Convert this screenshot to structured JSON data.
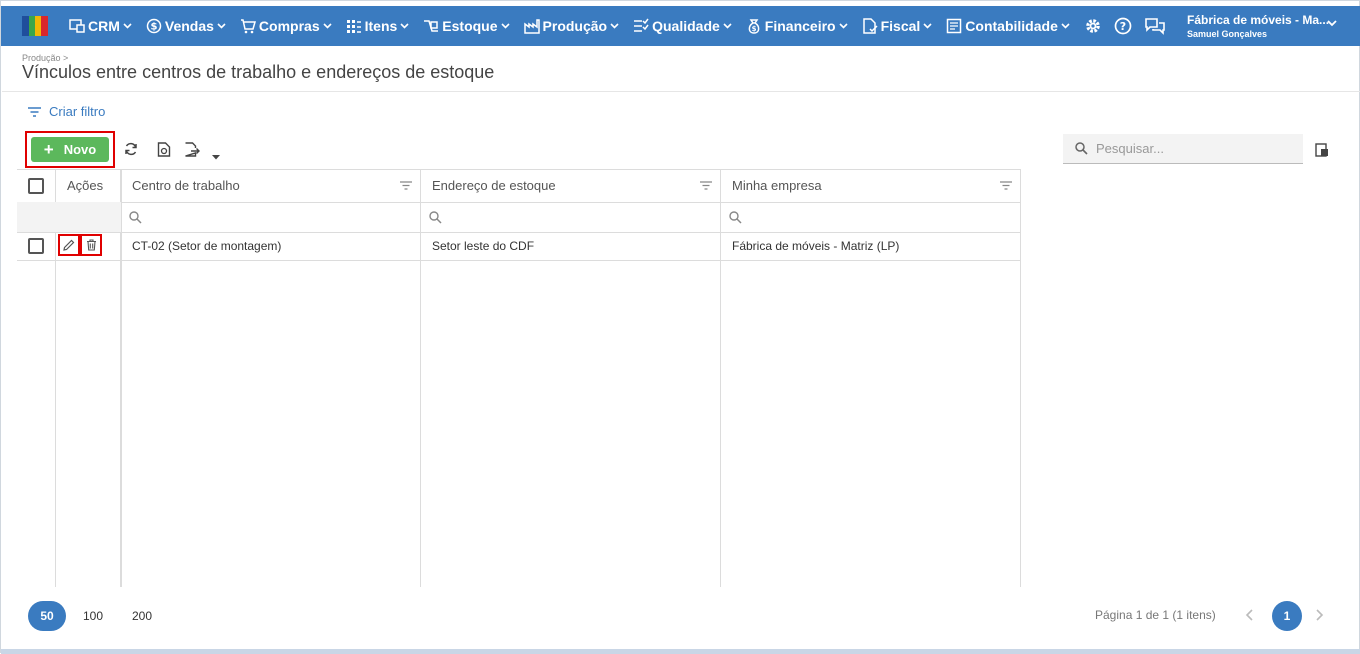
{
  "nav": {
    "items": [
      {
        "label": "CRM",
        "icon": "crm-icon"
      },
      {
        "label": "Vendas",
        "icon": "dollar-icon"
      },
      {
        "label": "Compras",
        "icon": "cart-icon"
      },
      {
        "label": "Itens",
        "icon": "items-icon"
      },
      {
        "label": "Estoque",
        "icon": "stock-icon"
      },
      {
        "label": "Produção",
        "icon": "factory-icon"
      },
      {
        "label": "Qualidade",
        "icon": "checklist-icon"
      },
      {
        "label": "Financeiro",
        "icon": "money-bag-icon"
      },
      {
        "label": "Fiscal",
        "icon": "document-check-icon"
      },
      {
        "label": "Contabilidade",
        "icon": "ledger-icon"
      }
    ],
    "company_name": "Fábrica de móveis - Ma...",
    "user_name": "Samuel Gonçalves",
    "accent_color": "#3a7bc0"
  },
  "header": {
    "breadcrumb": "Produção >",
    "title": "Vínculos entre centros de trabalho e endereços de estoque"
  },
  "toolbar": {
    "filter_label": "Criar filtro",
    "new_label": "Novo",
    "search_placeholder": "Pesquisar..."
  },
  "grid": {
    "columns": [
      "Ações",
      "Centro de trabalho",
      "Endereço de estoque",
      "Minha empresa"
    ],
    "rows": [
      {
        "centro": "CT-02 (Setor de montagem)",
        "endereco": "Setor leste do CDF",
        "empresa": "Fábrica de móveis - Matriz (LP)"
      }
    ]
  },
  "pager": {
    "sizes": [
      "50",
      "100",
      "200"
    ],
    "active_size": "50",
    "info": "Página 1 de 1 (1 itens)",
    "current_page": "1"
  }
}
